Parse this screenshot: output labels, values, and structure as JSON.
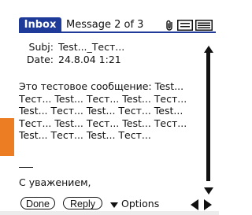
{
  "colors": {
    "accent": "#1f3b9a",
    "orange_band": "#ec7d23",
    "text": "#111111",
    "background": "#ffffff"
  },
  "header": {
    "tab_label": "Inbox",
    "message_counter": "Message 2 of 3",
    "icons": [
      "attachment-icon",
      "view-mode-icon-1",
      "view-mode-icon-2"
    ]
  },
  "message": {
    "subject_label": "Subj:",
    "subject_value": "Test..._Тест...",
    "date_label": "Date:",
    "date_value": "24.8.04 1:21",
    "body_lines": [
      "Это тестовое сообщение: Test...",
      "Тест... Test... Тест... Test... Тест...",
      "Test... Тест... Test... Тест... Test...",
      "Тест... Test... Тест... Test... Тест...",
      "Test... Тест... Test... Тест..."
    ],
    "signature": "С уважением,"
  },
  "scrollbar": {
    "icons": [
      "scroll-up-icon",
      "scroll-down-icon"
    ]
  },
  "footer": {
    "done_label": "Done",
    "reply_label": "Reply",
    "options_label": "Options",
    "icons": [
      "options-triangle-icon",
      "prev-message-icon",
      "next-message-icon"
    ]
  }
}
